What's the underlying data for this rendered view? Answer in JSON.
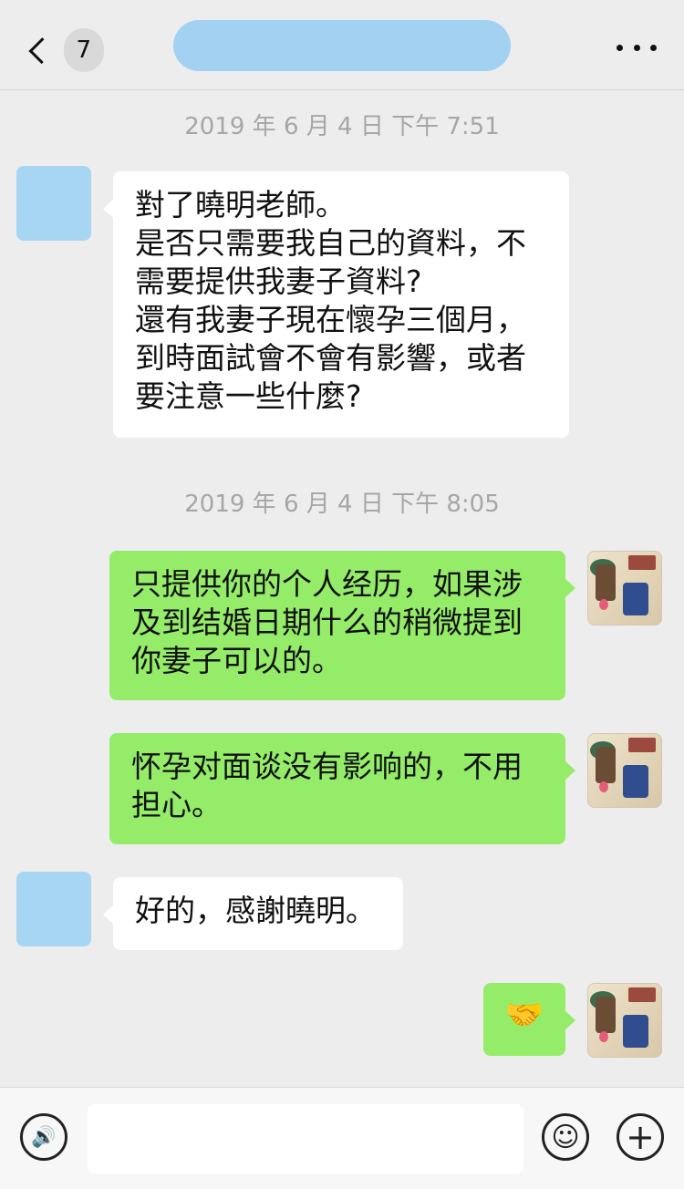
{
  "header": {
    "unread_count": "7",
    "back_icon": "chevron-left-icon",
    "more_icon": "more-horizontal-icon"
  },
  "messages": {
    "ts1": "2019 年 6 月 4 日 下午 7:51",
    "msg1": "對了曉明老師。\n是否只需要我自己的資料，不需要提供我妻子資料?\n還有我妻子現在懷孕三個月，到時面試會不會有影響，或者要注意一些什麼?",
    "ts2": "2019 年 6 月 4 日 下午 8:05",
    "msg2": "只提供你的个人经历，如果涉及到结婚日期什么的稍微提到你妻子可以的。",
    "msg3": "怀孕对面谈没有影响的，不用担心。",
    "msg4": "好的，感謝曉明。",
    "msg5": "🤝"
  },
  "input": {
    "voice_icon": "voice-icon",
    "emoji_icon": "emoji-icon",
    "plus_icon": "plus-icon",
    "voice_glyph": "🔊",
    "emoji_glyph": "☺",
    "plus_glyph": "+",
    "placeholder": ""
  },
  "colors": {
    "background": "#ededed",
    "bubble_in": "#ffffff",
    "bubble_out": "#95ec69",
    "timestamp": "#a6a6a6"
  }
}
